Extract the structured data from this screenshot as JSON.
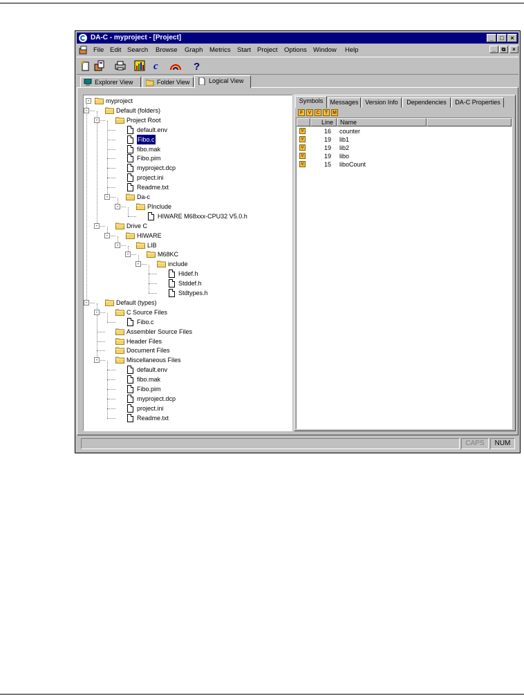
{
  "window": {
    "title": "DA-C - myproject - [Project]",
    "caption_buttons": [
      "_",
      "□",
      "×"
    ],
    "mdi_buttons": [
      "_",
      "⧉",
      "×"
    ]
  },
  "menu": [
    "File",
    "Edit",
    "Search",
    "Browse",
    "Graph",
    "Metrics",
    "Start",
    "Project",
    "Options",
    "Window",
    "Help"
  ],
  "toolbar": [
    {
      "icon": "new-project-icon"
    },
    {
      "icon": "open-project-icon"
    },
    {
      "icon": "print-icon"
    },
    {
      "icon": "chart-icon"
    },
    {
      "icon": "c-compiler-icon",
      "glyph": "c"
    },
    {
      "icon": "rainbow-icon"
    },
    {
      "icon": "help-icon",
      "glyph": "?"
    }
  ],
  "view_tabs": [
    {
      "label": "Explorer View",
      "icon": "computer-icon"
    },
    {
      "label": "Folder View",
      "icon": "folder-icon"
    },
    {
      "label": "Logical View",
      "icon": "document-icon",
      "active": true
    }
  ],
  "tree": [
    {
      "label": "myproject",
      "type": "folder",
      "depth": 0,
      "expander": "-"
    },
    {
      "label": "Default (folders)",
      "type": "folder",
      "depth": 1,
      "expander": "-"
    },
    {
      "label": "Project Root",
      "type": "folder",
      "depth": 2,
      "expander": "-"
    },
    {
      "label": "default.env",
      "type": "file",
      "depth": 3
    },
    {
      "label": "Fibo.c",
      "type": "file",
      "depth": 3,
      "selected": true
    },
    {
      "label": "fibo.mak",
      "type": "file",
      "depth": 3
    },
    {
      "label": "Fibo.pim",
      "type": "file",
      "depth": 3
    },
    {
      "label": "myproject.dcp",
      "type": "file",
      "depth": 3
    },
    {
      "label": "project.ini",
      "type": "file",
      "depth": 3
    },
    {
      "label": "Readme.txt",
      "type": "file",
      "depth": 3
    },
    {
      "label": "Da-c",
      "type": "folder",
      "depth": 3,
      "expander": "-"
    },
    {
      "label": "PInclude",
      "type": "folder",
      "depth": 4,
      "expander": "-"
    },
    {
      "label": "HIWARE M68xxx-CPU32 V5.0.h",
      "type": "file",
      "depth": 5
    },
    {
      "label": "Drive C",
      "type": "folder",
      "depth": 2,
      "expander": "-"
    },
    {
      "label": "HIWARE",
      "type": "folder",
      "depth": 3,
      "expander": "-"
    },
    {
      "label": "LIB",
      "type": "folder",
      "depth": 4,
      "expander": "-"
    },
    {
      "label": "M68KC",
      "type": "folder",
      "depth": 5,
      "expander": "-"
    },
    {
      "label": "include",
      "type": "folder",
      "depth": 6,
      "expander": "-"
    },
    {
      "label": "Hidef.h",
      "type": "file",
      "depth": 7
    },
    {
      "label": "Stddef.h",
      "type": "file",
      "depth": 7
    },
    {
      "label": "Stdtypes.h",
      "type": "file",
      "depth": 7
    },
    {
      "label": "Default (types)",
      "type": "folder",
      "depth": 1,
      "expander": "-"
    },
    {
      "label": "C Source Files",
      "type": "folder",
      "depth": 2,
      "expander": "-"
    },
    {
      "label": "Fibo.c",
      "type": "file",
      "depth": 3
    },
    {
      "label": "Assembler Source Files",
      "type": "folder",
      "depth": 2
    },
    {
      "label": "Header Files",
      "type": "folder",
      "depth": 2
    },
    {
      "label": "Document Files",
      "type": "folder",
      "depth": 2
    },
    {
      "label": "Miscellaneous Files",
      "type": "folder",
      "depth": 2,
      "expander": "-"
    },
    {
      "label": "default.env",
      "type": "file",
      "depth": 3
    },
    {
      "label": "fibo.mak",
      "type": "file",
      "depth": 3
    },
    {
      "label": "Fibo.pim",
      "type": "file",
      "depth": 3
    },
    {
      "label": "myproject.dcp",
      "type": "file",
      "depth": 3
    },
    {
      "label": "project.ini",
      "type": "file",
      "depth": 3
    },
    {
      "label": "Readme.txt",
      "type": "file",
      "depth": 3
    }
  ],
  "right_tabs": [
    "Symbols",
    "Messages",
    "Version Info",
    "Dependencies",
    "DA-C Properties"
  ],
  "filters": [
    "F",
    "V",
    "C",
    "T",
    "M"
  ],
  "symbols": {
    "columns": [
      "",
      "Line",
      "Name"
    ],
    "rows": [
      {
        "kind": "V",
        "line": "16",
        "name": "counter"
      },
      {
        "kind": "V",
        "line": "19",
        "name": "lib1"
      },
      {
        "kind": "V",
        "line": "19",
        "name": "lib2"
      },
      {
        "kind": "V",
        "line": "19",
        "name": "libo"
      },
      {
        "kind": "V",
        "line": "15",
        "name": "liboCount"
      }
    ]
  },
  "status": {
    "caps": "CAPS",
    "num": "NUM"
  }
}
